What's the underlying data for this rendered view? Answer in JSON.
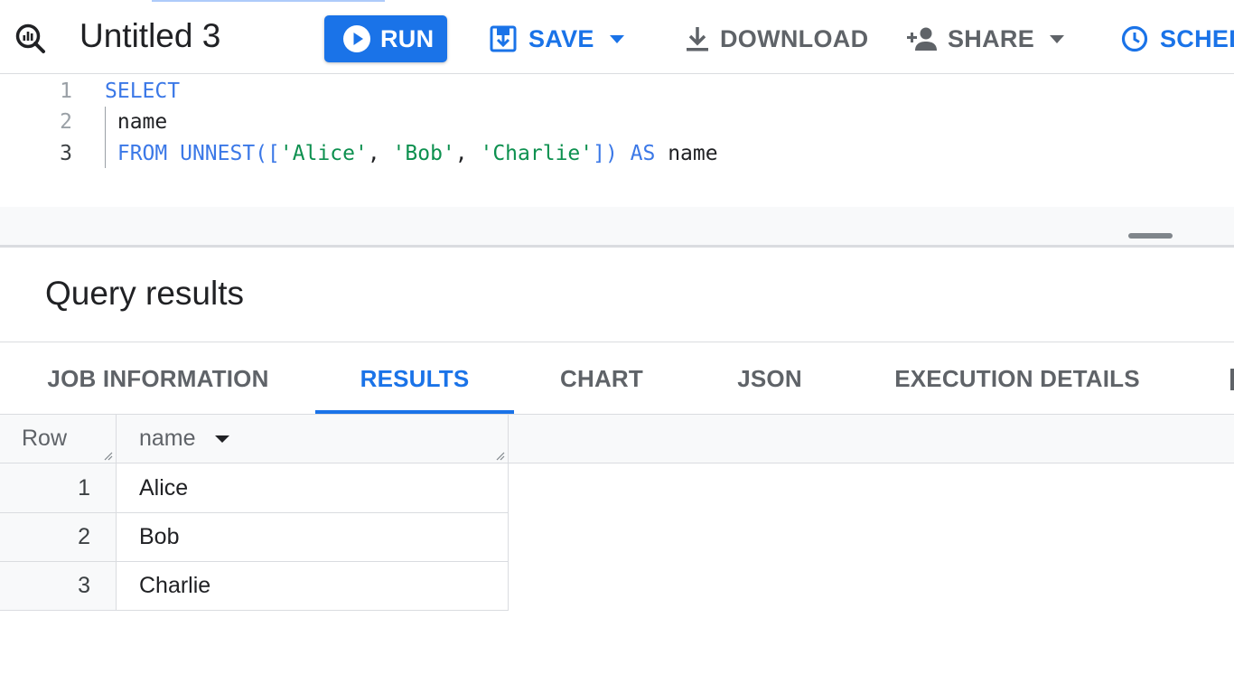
{
  "toolbar": {
    "query_title": "Untitled 3",
    "run_label": "RUN",
    "save_label": "SAVE",
    "download_label": "DOWNLOAD",
    "share_label": "SHARE",
    "schedule_label": "SCHED",
    "colors": {
      "primary": "#1a73e8",
      "secondary": "#5f6368"
    }
  },
  "editor": {
    "line_numbers": [
      "1",
      "2",
      "3"
    ],
    "lines": [
      [
        {
          "t": "SELECT",
          "c": "kw"
        }
      ],
      [
        {
          "t": " name",
          "c": "plain"
        }
      ],
      [
        {
          "t": " FROM ",
          "c": "kw"
        },
        {
          "t": "UNNEST",
          "c": "kw"
        },
        {
          "t": "([",
          "c": "punct"
        },
        {
          "t": "'Alice'",
          "c": "str"
        },
        {
          "t": ", ",
          "c": "plain"
        },
        {
          "t": "'Bob'",
          "c": "str"
        },
        {
          "t": ", ",
          "c": "plain"
        },
        {
          "t": "'Charlie'",
          "c": "str"
        },
        {
          "t": "]) ",
          "c": "punct"
        },
        {
          "t": "AS",
          "c": "kw"
        },
        {
          "t": " name",
          "c": "plain"
        }
      ]
    ]
  },
  "results": {
    "title": "Query results",
    "tabs": [
      {
        "label": "JOB INFORMATION",
        "active": false
      },
      {
        "label": "RESULTS",
        "active": true
      },
      {
        "label": "CHART",
        "active": false
      },
      {
        "label": "JSON",
        "active": false
      },
      {
        "label": "EXECUTION DETAILS",
        "active": false
      }
    ],
    "table": {
      "headers": [
        "Row",
        "name"
      ],
      "rows": [
        {
          "row": "1",
          "name": "Alice"
        },
        {
          "row": "2",
          "name": "Bob"
        },
        {
          "row": "3",
          "name": "Charlie"
        }
      ]
    }
  }
}
